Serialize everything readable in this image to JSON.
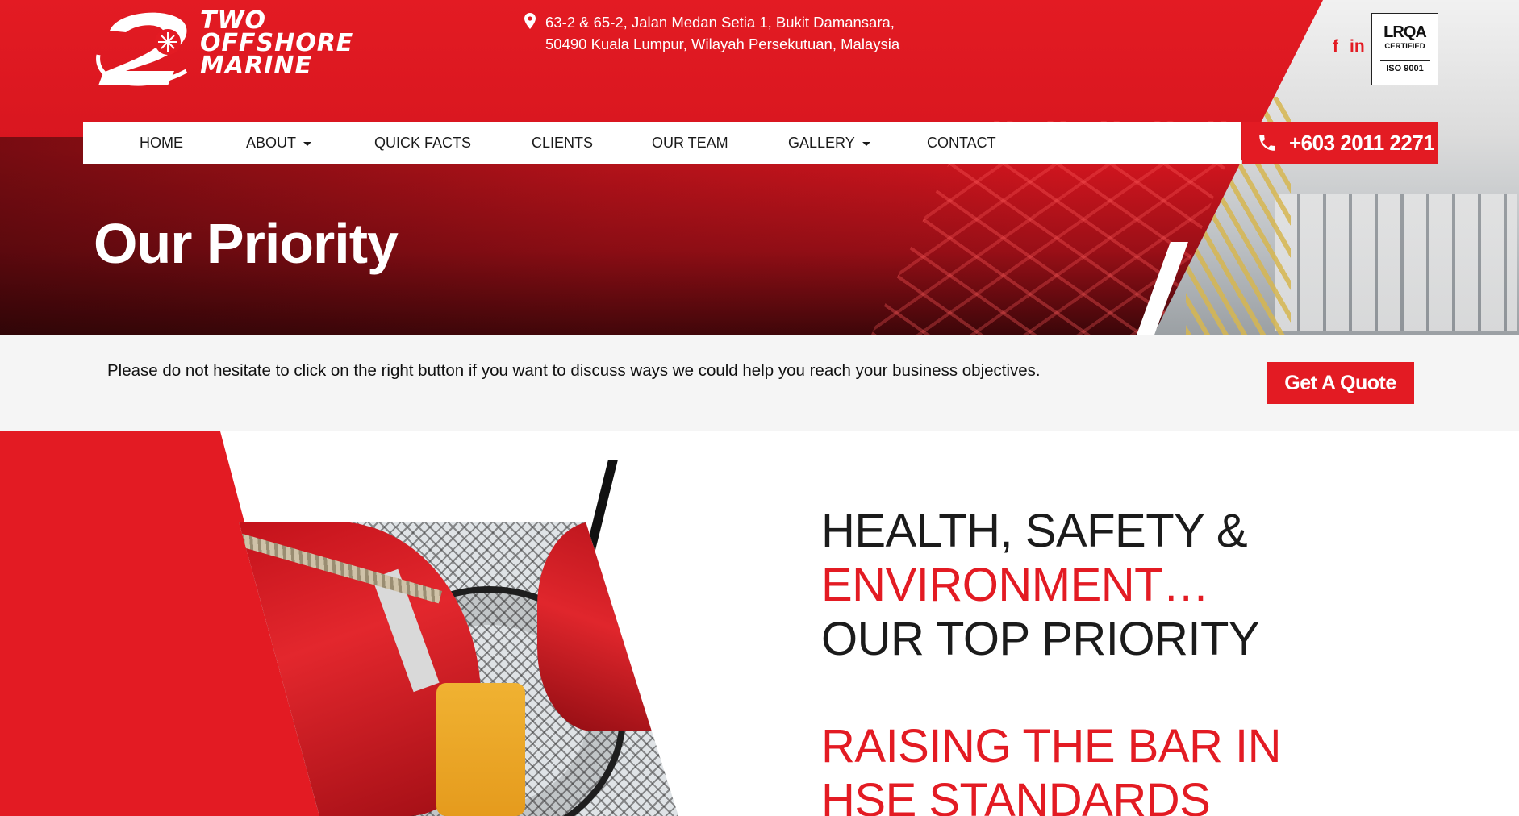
{
  "brand": {
    "logo_line1": "TWO",
    "logo_line2": "OFFSHORE",
    "logo_line3": "MARINE",
    "primary_color": "#e31b23"
  },
  "address": {
    "icon": "map-pin-icon",
    "line1": "63-2 & 65-2, Jalan Medan Setia 1, Bukit Damansara,",
    "line2": "50490 Kuala Lumpur, Wilayah Persekutuan, Malaysia"
  },
  "social": {
    "facebook": "f",
    "linkedin": "in"
  },
  "cert": {
    "name": "LRQA",
    "status": "CERTIFIED",
    "standard": "ISO 9001"
  },
  "nav": {
    "items": [
      {
        "label": "HOME",
        "dropdown": false
      },
      {
        "label": "ABOUT",
        "dropdown": true
      },
      {
        "label": "QUICK FACTS",
        "dropdown": false
      },
      {
        "label": "CLIENTS",
        "dropdown": false
      },
      {
        "label": "OUR TEAM",
        "dropdown": false
      },
      {
        "label": "GALLERY",
        "dropdown": true
      },
      {
        "label": "CONTACT",
        "dropdown": false
      }
    ],
    "phone": "+603 2011 2271"
  },
  "hero": {
    "title": "Our Priority"
  },
  "cta": {
    "text": "Please do not hesitate to click on the right button if you want to discuss ways we could help you reach your business objectives.",
    "button": "Get A Quote"
  },
  "hse": {
    "line1": "HEALTH, SAFETY &",
    "line2": "ENVIRONMENT…",
    "line3": "OUR TOP PRIORITY",
    "sub1": "RAISING THE BAR IN",
    "sub2": "HSE STANDARDS"
  }
}
